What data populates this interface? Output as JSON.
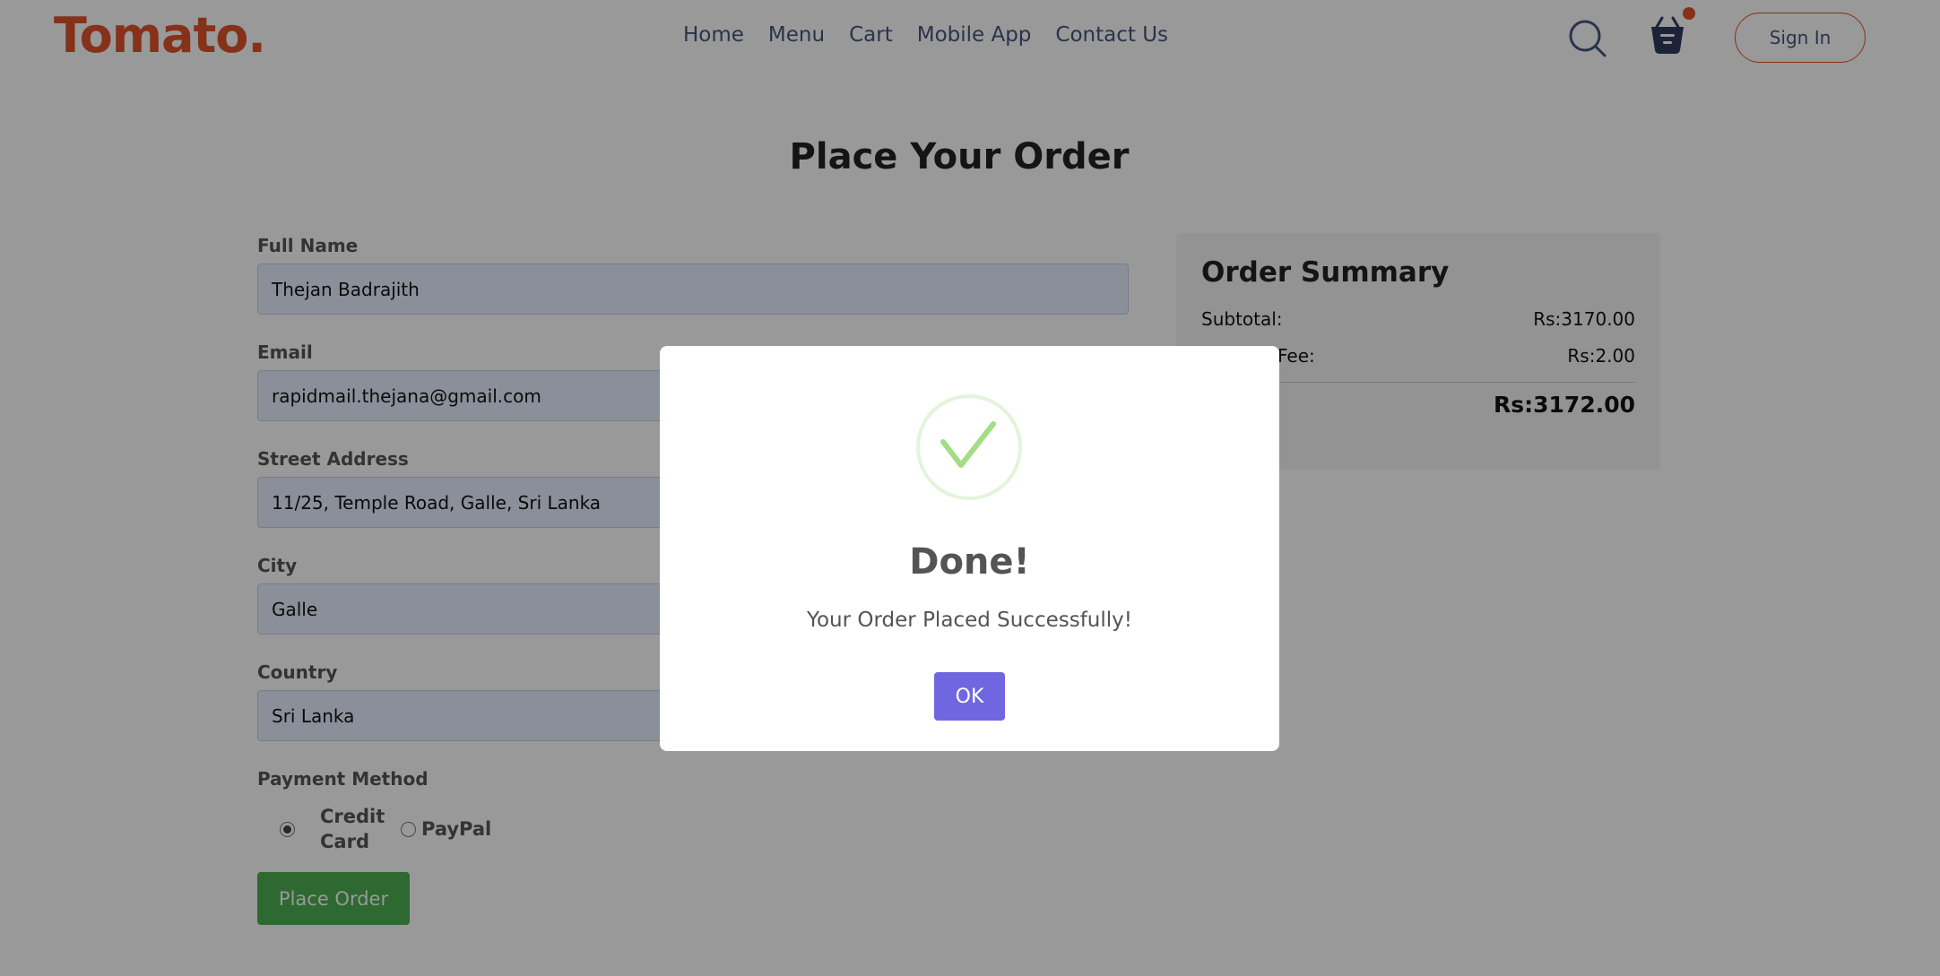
{
  "header": {
    "logo": "Tomato.",
    "nav": [
      "Home",
      "Menu",
      "Cart",
      "Mobile App",
      "Contact Us"
    ],
    "sign_in": "Sign In",
    "cart_has_items": true
  },
  "page_title": "Place Your Order",
  "form": {
    "fields": [
      {
        "label": "Full Name",
        "value": "Thejan Badrajith"
      },
      {
        "label": "Email",
        "value": "rapidmail.thejana@gmail.com"
      },
      {
        "label": "Street Address",
        "value": "11/25, Temple Road, Galle, Sri Lanka"
      },
      {
        "label": "City",
        "value": "Galle"
      },
      {
        "label": "Country",
        "value": "Sri Lanka"
      }
    ],
    "payment_label": "Payment Method",
    "payment_options": [
      "Credit Card",
      "PayPal"
    ],
    "payment_selected": "Credit Card",
    "submit": "Place Order"
  },
  "summary": {
    "title": "Order Summary",
    "subtotal_label": "Subtotal:",
    "subtotal": "Rs:3170.00",
    "fee_label": "Fee:",
    "fee": "Rs:2.00",
    "total": "Rs:3172.00"
  },
  "modal": {
    "title": "Done!",
    "message": "Your Order Placed Successfully!",
    "ok": "OK",
    "accent": "#7066e0",
    "icon": "success-check"
  }
}
